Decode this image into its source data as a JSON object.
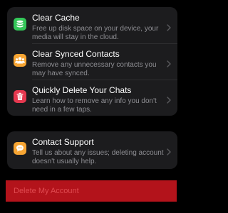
{
  "items": [
    {
      "title": "Clear Cache",
      "subtitle": "Free up disk space on your device, your media will stay in the cloud.",
      "icon": "database-icon",
      "color": "#34c759"
    },
    {
      "title": "Clear Synced Contacts",
      "subtitle": "Remove any unnecessary contacts you may have synced.",
      "icon": "contacts-icon",
      "color": "#f7a533"
    },
    {
      "title": "Quickly Delete Your Chats",
      "subtitle": "Learn how to remove any info you don't need in a few taps.",
      "icon": "trash-icon",
      "color": "#e5384f"
    }
  ],
  "support": {
    "title": "Contact Support",
    "subtitle": "Tell us about any issues; deleting account doesn't usually help.",
    "icon": "chat-bubble-icon",
    "color": "#f7a533"
  },
  "delete_account": {
    "label": "Delete My Account",
    "color": "#b3131b"
  }
}
